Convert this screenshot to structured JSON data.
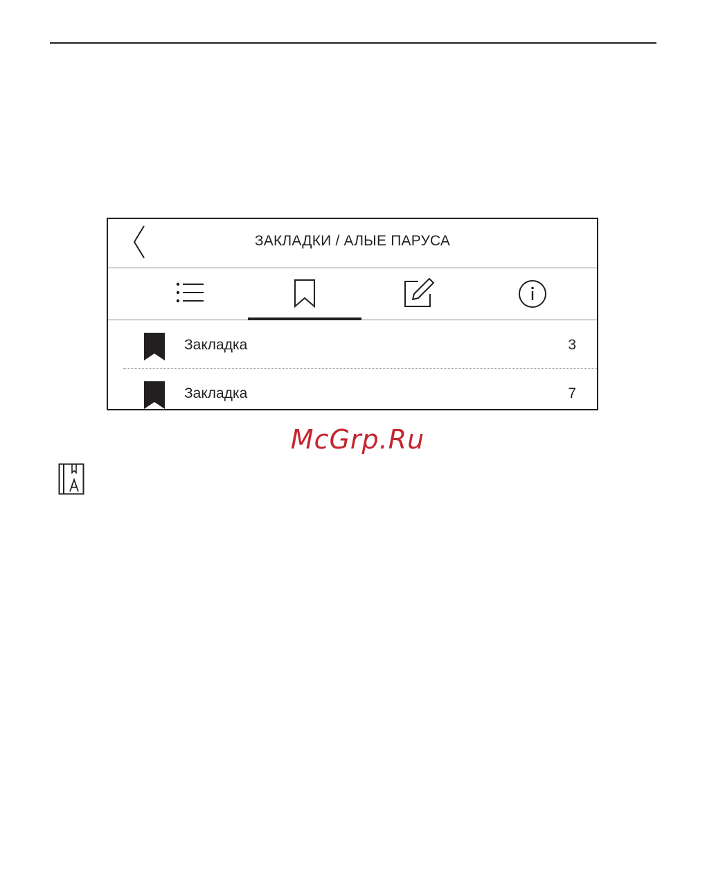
{
  "header": {
    "title": "ЗАКЛАДКИ / АЛЫЕ ПАРУСА"
  },
  "tabs": [
    {
      "icon": "list-icon",
      "active": false
    },
    {
      "icon": "bookmark-outline-icon",
      "active": true
    },
    {
      "icon": "edit-note-icon",
      "active": false
    },
    {
      "icon": "info-icon",
      "active": false
    }
  ],
  "bookmarks": [
    {
      "label": "Закладка",
      "page": "3"
    },
    {
      "label": "Закладка",
      "page": "7"
    }
  ],
  "watermark": "McGrp.Ru",
  "colors": {
    "ink": "#231f20",
    "watermark": "#c4262e",
    "divider": "#8a8a8a"
  }
}
